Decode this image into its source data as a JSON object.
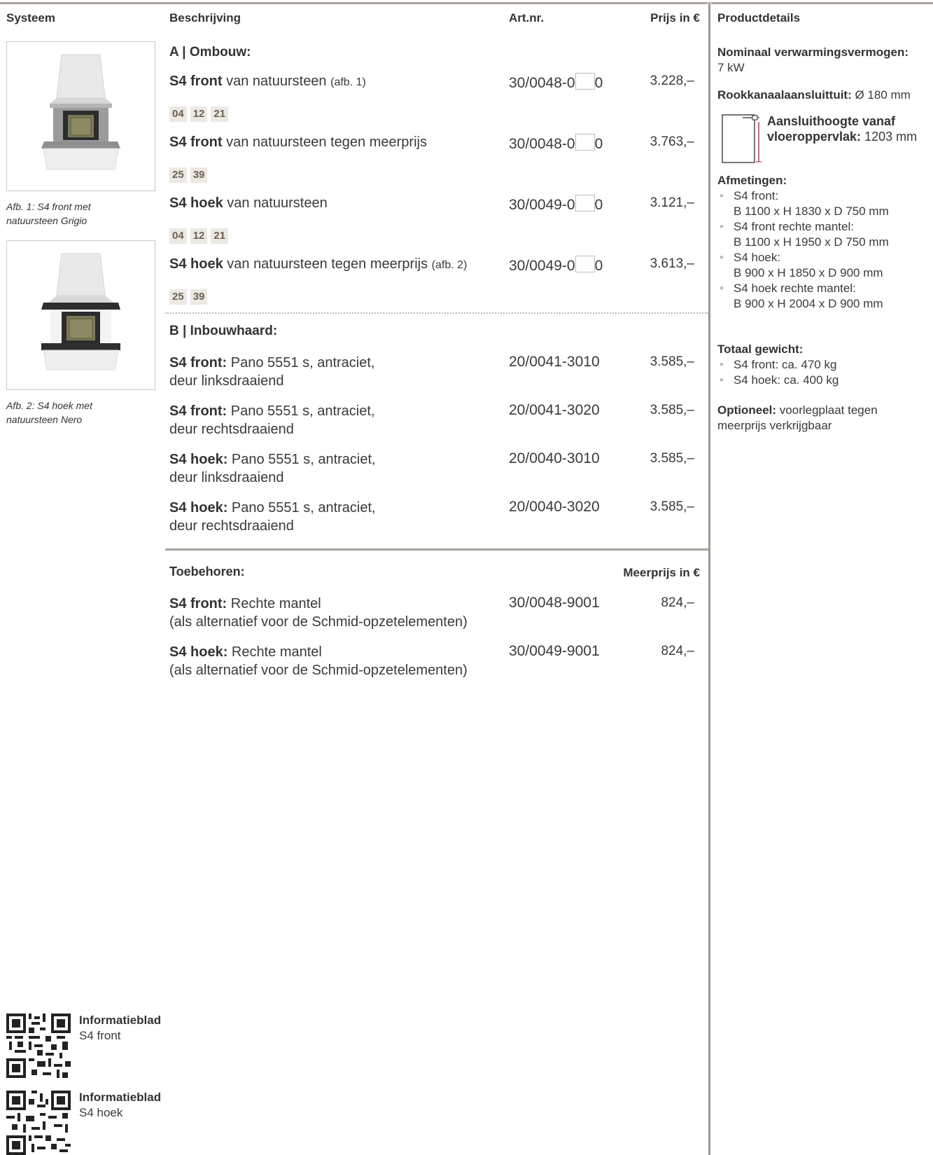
{
  "header": {
    "systeem": "Systeem",
    "beschrijving": "Beschrijving",
    "artnr": "Art.nr.",
    "prijs": "Prijs in €",
    "productdetails": "Productdetails"
  },
  "images": [
    {
      "caption_line1": "Afb. 1: S4 front met",
      "caption_line2": "natuursteen Grigio"
    },
    {
      "caption_line1": "Afb. 2: S4 hoek met",
      "caption_line2": "natuursteen Nero"
    }
  ],
  "section_a": {
    "title": "A | Ombouw:",
    "rows": [
      {
        "bold": "S4 front",
        "text": " van natuursteen ",
        "small": "(afb. 1)",
        "art_prefix": "30/0048-0",
        "art_suffix": "0",
        "price": "3.228,–",
        "codes": [
          "04",
          "12",
          "21"
        ]
      },
      {
        "bold": "S4 front",
        "text": " van natuursteen tegen meerprijs",
        "small": "",
        "art_prefix": "30/0048-0",
        "art_suffix": "0",
        "price": "3.763,–",
        "codes": [
          "25",
          "39"
        ]
      },
      {
        "bold": "S4 hoek",
        "text": " van natuursteen",
        "small": "",
        "art_prefix": "30/0049-0",
        "art_suffix": "0",
        "price": "3.121,–",
        "codes": [
          "04",
          "12",
          "21"
        ]
      },
      {
        "bold": "S4 hoek",
        "text": " van natuursteen tegen meerprijs ",
        "small": "(afb. 2)",
        "art_prefix": "30/0049-0",
        "art_suffix": "0",
        "price": "3.613,–",
        "codes": [
          "25",
          "39"
        ]
      }
    ]
  },
  "section_b": {
    "title": "B | Inbouwhaard:",
    "rows": [
      {
        "bold": "S4 front:",
        "line1": " Pano 5551 s, antraciet,",
        "line2": "deur linksdraaiend",
        "art": "20/0041-3010",
        "price": "3.585,–"
      },
      {
        "bold": "S4 front:",
        "line1": " Pano 5551 s, antraciet,",
        "line2": "deur rechtsdraaiend",
        "art": "20/0041-3020",
        "price": "3.585,–"
      },
      {
        "bold": "S4 hoek:",
        "line1": " Pano 5551 s, antraciet,",
        "line2": "deur linksdraaiend",
        "art": "20/0040-3010",
        "price": "3.585,–"
      },
      {
        "bold": "S4 hoek:",
        "line1": " Pano 5551 s, antraciet,",
        "line2": "deur rechtsdraaiend",
        "art": "20/0040-3020",
        "price": "3.585,–"
      }
    ]
  },
  "accessories": {
    "title": "Toebehoren:",
    "price_header": "Meerprijs in €",
    "rows": [
      {
        "bold": "S4 front:",
        "line1": " Rechte mantel",
        "line2": "(als alternatief voor de Schmid-opzetelementen)",
        "art": "30/0048-9001",
        "price": "824,–"
      },
      {
        "bold": "S4 hoek:",
        "line1": " Rechte mantel",
        "line2": "(als alternatief voor de Schmid-opzetelementen)",
        "art": "30/0049-9001",
        "price": "824,–"
      }
    ]
  },
  "details": {
    "power_label": "Nominaal verwarmingsvermogen:",
    "power_value": "7 kW",
    "flue_label": "Rookkanaalaansluittuit:",
    "flue_value": " Ø 180 mm",
    "height_label_1": "Aansluithoogte vanaf",
    "height_label_2": "vloeroppervlak:",
    "height_value": " 1203 mm",
    "dims_label": "Afmetingen:",
    "dims": [
      {
        "name": "S4 front:",
        "value": "B 1100 x H 1830 x D 750 mm"
      },
      {
        "name": "S4 front rechte mantel:",
        "value": "B 1100 x H 1950 x D 750 mm"
      },
      {
        "name": "S4 hoek:",
        "value": "B 900 x H 1850 x D 900 mm"
      },
      {
        "name": "S4 hoek rechte mantel:",
        "value": "B 900 x H 2004 x D 900 mm"
      }
    ],
    "weight_label": "Totaal gewicht:",
    "weights": [
      "S4 front: ca. 470 kg",
      "S4 hoek: ca. 400 kg"
    ],
    "optional_label": "Optioneel:",
    "optional_line1": " voorlegplaat tegen",
    "optional_line2": "meerprijs verkrijgbaar"
  },
  "infosheets": [
    {
      "title": "Informatieblad",
      "subtitle": "S4 front"
    },
    {
      "title": "Informatieblad",
      "subtitle": "S4 hoek"
    }
  ],
  "colors": {
    "rule": "#a8a39c",
    "code_bg": "#ece8e3",
    "code_text": "#6b6054",
    "accent_line": "#c03060"
  }
}
